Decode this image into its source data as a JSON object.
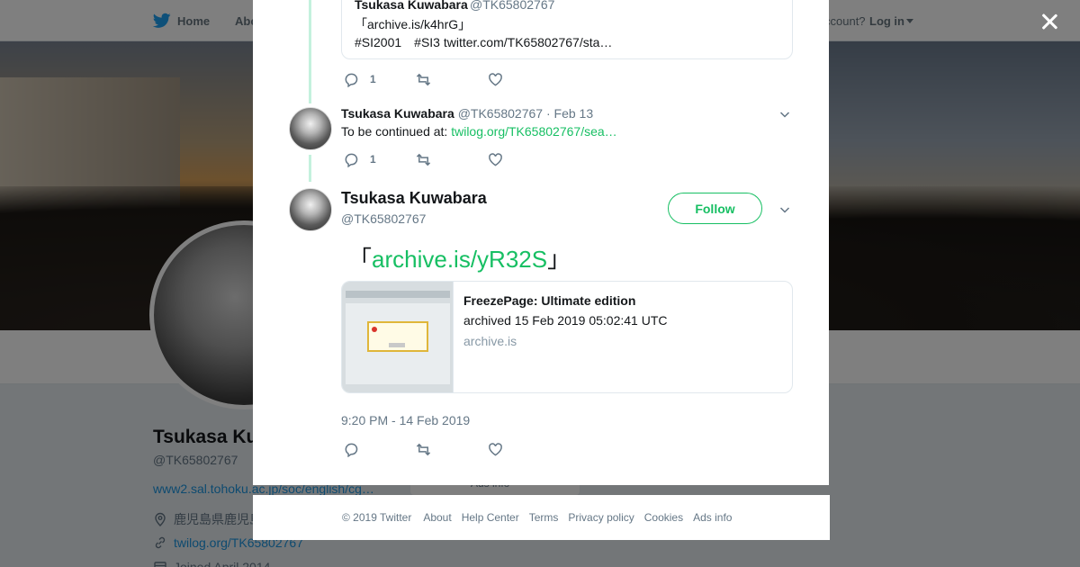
{
  "colors": {
    "accent": "#17bf63",
    "thread_line": "#c4f1dd",
    "muted": "#657786",
    "link_blue": "#1b95e0"
  },
  "topnav": {
    "home": "Home",
    "about": "Abo",
    "account_q": "ccount?",
    "login": "Log in"
  },
  "profile": {
    "name": "Tsukasa Ku",
    "handle": "@TK65802767",
    "url": "www2.sal.tohoku.ac.jp/soc/english/cg…",
    "location": "鹿児島県鹿児島",
    "website": "twilog.org/TK65802767",
    "joined": "Joined April 2014",
    "ads_card": "Ads info"
  },
  "modal": {
    "quoted": {
      "name": "Tsukasa Kuwabara",
      "handle": "@TK65802767",
      "line1": "「archive.is/k4hrG」",
      "line2": "#SI2001　#SI3 twitter.com/TK65802767/sta…"
    },
    "tweet1_actions": {
      "replies": "1",
      "retweets": "",
      "likes": ""
    },
    "tweet2": {
      "name": "Tsukasa Kuwabara",
      "handle": "@TK65802767",
      "date": "· Feb 13",
      "text_prefix": "To be continued at: ",
      "link": "twilog.org/TK65802767/sea…",
      "replies": "1"
    },
    "tweet3": {
      "name": "Tsukasa Kuwabara",
      "handle": "@TK65802767",
      "follow": "Follow",
      "bracket_open": "「",
      "link": "archive.is/yR32S",
      "bracket_close": "」",
      "card_title": "FreezePage: Ultimate edition",
      "card_desc": "archived 15 Feb 2019 05:02:41 UTC",
      "card_domain": "archive.is",
      "timestamp": "9:20 PM - 14 Feb 2019"
    }
  },
  "footer": {
    "copyright": "© 2019 Twitter",
    "links": [
      "About",
      "Help Center",
      "Terms",
      "Privacy policy",
      "Cookies",
      "Ads info"
    ]
  },
  "icons": [
    "twitter-bird-icon",
    "close-icon",
    "reply-icon",
    "retweet-icon",
    "like-icon",
    "chevron-down-icon",
    "location-icon",
    "link-icon",
    "calendar-icon"
  ]
}
